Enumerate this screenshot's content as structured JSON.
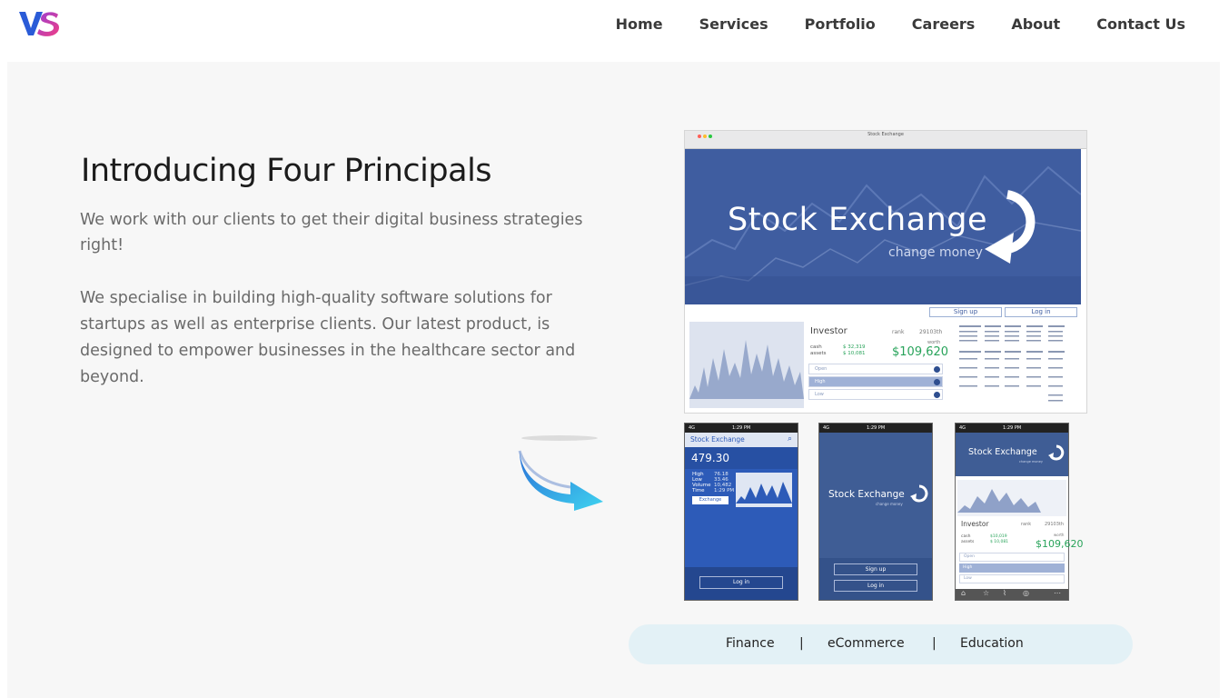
{
  "brand": {
    "logo_text": "VS",
    "colors": {
      "v": "#2a5bd7",
      "s": "#e23d8f"
    }
  },
  "nav": {
    "items": [
      "Home",
      "Services",
      "Portfolio",
      "Careers",
      "About",
      "Contact Us"
    ]
  },
  "hero": {
    "title": "Introducing Four Principals",
    "p1": "We work with our clients to get their digital business strategies right!",
    "p2": "We specialise in building high-quality software solutions for startups as well as enterprise clients. Our latest product, is designed to empower businesses in the healthcare sector and beyond."
  },
  "mockup": {
    "browser_title": "Stock Exchange",
    "banner_title": "Stock Exchange",
    "banner_sub": "change money",
    "sign_up": "Sign up",
    "log_in": "Log in",
    "investor_label": "Investor",
    "rank_label": "rank",
    "rank_value": "29103th",
    "worth_label": "worth",
    "worth_value": "$109,620",
    "cash_label": "cash",
    "assets_label": "assets",
    "cash_value": "$ 32,319",
    "assets_value": "$ 10,081",
    "rows": [
      "Open",
      "High",
      "Low"
    ],
    "phone1": {
      "time": "1:29 PM",
      "network": "4G",
      "app_title": "Stock Exchange",
      "price": "479.30",
      "stats": [
        "High",
        "Low",
        "Volume",
        "Time"
      ],
      "stats_values": [
        "76.18",
        "33.46",
        "10,482",
        "1:29 PM"
      ],
      "button": "Exchange",
      "login": "Log in"
    },
    "phone2": {
      "time": "1:29 PM",
      "network": "4G",
      "title": "Stock Exchange",
      "sub": "change money",
      "sign_up": "Sign up",
      "log_in": "Log in"
    },
    "phone3": {
      "time": "1:29 PM",
      "network": "4G",
      "title": "Stock Exchange",
      "sub": "change money",
      "investor": "Investor",
      "rank": "rank",
      "rank_value": "29103th",
      "worth": "worth",
      "worth_value": "$109,620",
      "cash": "cash",
      "assets": "assets",
      "cash_value": "$10,019",
      "assets_value": "$ 10,081",
      "rows": [
        "Open",
        "High",
        "Low"
      ]
    }
  },
  "categories": [
    "Finance",
    "eCommerce",
    "Education"
  ],
  "category_separator": "|",
  "colors": {
    "hero_bg": "#f7f7f7",
    "pill_bg": "#e3f1f6",
    "banner_blue": "#3f5da0",
    "worth_green": "#28a35a",
    "arrow_start": "#2a6fd6",
    "arrow_end": "#3fd4f0"
  }
}
